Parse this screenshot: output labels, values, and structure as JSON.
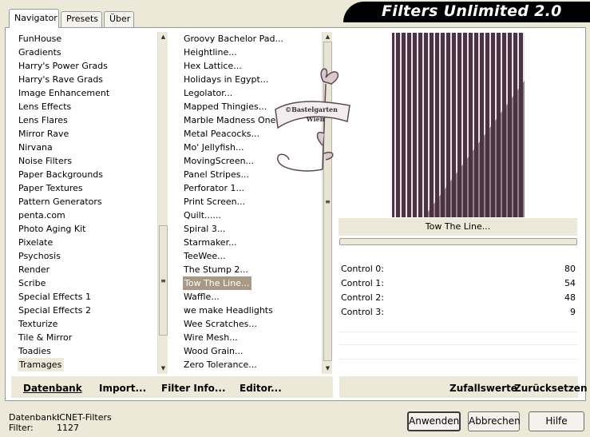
{
  "app": {
    "title": "Filters Unlimited 2.0"
  },
  "tabs": [
    "Navigator",
    "Presets",
    "Über"
  ],
  "categories": [
    "FunHouse",
    "Gradients",
    "Harry's Power Grads",
    "Harry's Rave Grads",
    "Image Enhancement",
    "Lens Effects",
    "Lens Flares",
    "Mirror Rave",
    "Nirvana",
    "Noise Filters",
    "Paper Backgrounds",
    "Paper Textures",
    "Pattern Generators",
    "penta.com",
    "Photo Aging Kit",
    "Pixelate",
    "Psychosis",
    "Render",
    "Scribe",
    "Special Effects 1",
    "Special Effects 2",
    "Texturize",
    "Tile & Mirror",
    "Toadies",
    "Tramages"
  ],
  "filters": [
    "Groovy Bachelor Pad...",
    "Heightline...",
    "Hex Lattice...",
    "Holidays in Egypt...",
    "Legolator...",
    "Mapped Thingies...",
    "Marble Madness One...",
    "Metal Peacocks...",
    "Mo' Jellyfish...",
    "MovingScreen...",
    "Panel Stripes...",
    "Perforator 1...",
    "Print Screen...",
    "Quilt......",
    "Spiral 3...",
    "Starmaker...",
    "TeeWee...",
    "The Stump 2...",
    "Tow The Line...",
    "Waffle...",
    "we make Headlights",
    "Wee Scratches...",
    "Wire Mesh...",
    "Wood Grain...",
    "Zero Tolerance..."
  ],
  "selected_category": "Tramages",
  "selected_filter": "Tow The Line...",
  "watermark": {
    "line1": "©Bastelgarten",
    "line2": "Wien"
  },
  "preview": {
    "filter_name": "Tow The Line..."
  },
  "controls": [
    {
      "label": "Control 0:",
      "value": "80"
    },
    {
      "label": "Control 1:",
      "value": "54"
    },
    {
      "label": "Control 2:",
      "value": "48"
    },
    {
      "label": "Control 3:",
      "value": "9"
    }
  ],
  "left_buttons": {
    "datenbank": "Datenbank",
    "import": "Import...",
    "filter_info": "Filter Info...",
    "editor": "Editor..."
  },
  "right_buttons": {
    "random": "Zufallswerte",
    "reset": "Zurücksetzen"
  },
  "status": {
    "db_label": "Datenbank:",
    "db_value": "ICNET-Filters",
    "filter_label": "Filter:",
    "filter_count": "1127"
  },
  "dialog_buttons": {
    "apply": "Anwenden",
    "cancel": "Abbrechen",
    "help": "Hilfe"
  },
  "colors": {
    "accent": "#a89886",
    "preview_bg": "#4c3343"
  }
}
